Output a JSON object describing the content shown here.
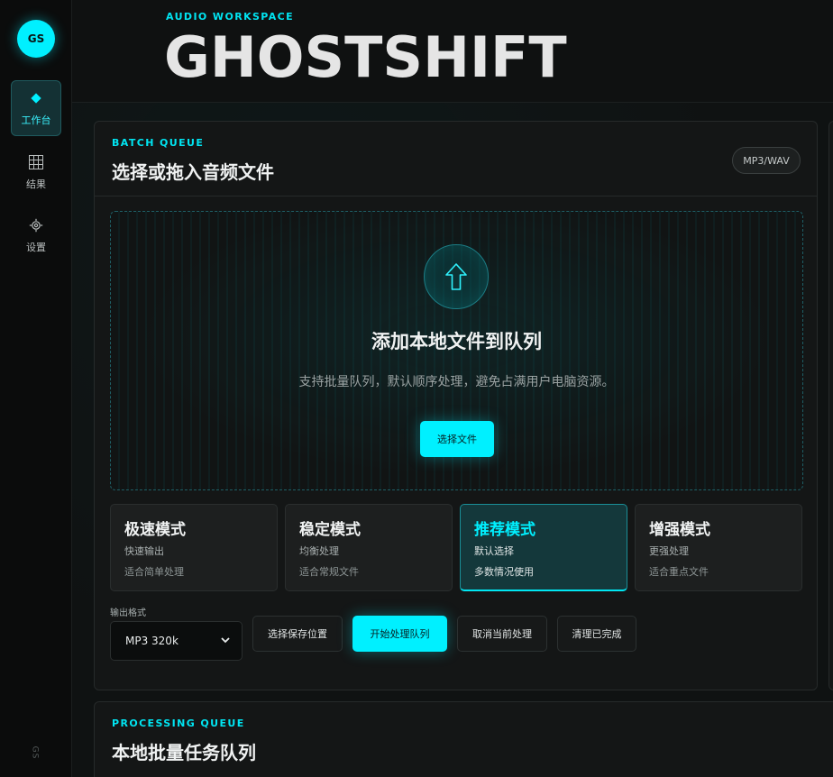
{
  "sidebar": {
    "avatar": "GS",
    "items": [
      {
        "label": "工作台",
        "icon": "diamond-icon"
      },
      {
        "label": "结果",
        "icon": "grid-icon"
      },
      {
        "label": "设置",
        "icon": "gear-icon"
      }
    ],
    "footer": "GS"
  },
  "header": {
    "eyebrow": "AUDIO WORKSPACE",
    "brand": "GHOSTSHIFT"
  },
  "batch": {
    "eyebrow": "BATCH QUEUE",
    "title": "选择或拖入音频文件",
    "badge": "MP3/WAV",
    "dropzone": {
      "title": "添加本地文件到队列",
      "subtitle": "支持批量队列，默认顺序处理，避免占满用户电脑资源。",
      "button": "选择文件"
    },
    "modes": [
      {
        "title": "极速模式",
        "sub": "快速输出",
        "desc": "适合简单处理",
        "active": false
      },
      {
        "title": "稳定模式",
        "sub": "均衡处理",
        "desc": "适合常规文件",
        "active": false
      },
      {
        "title": "推荐模式",
        "sub": "默认选择",
        "desc": "多数情况使用",
        "active": true
      },
      {
        "title": "增强模式",
        "sub": "更强处理",
        "desc": "适合重点文件",
        "active": false
      }
    ],
    "format_label": "输出格式",
    "format_value": "MP3 320k",
    "buttons": {
      "save_location": "选择保存位置",
      "start": "开始处理队列",
      "cancel": "取消当前处理",
      "clear": "清理已完成"
    }
  },
  "processing": {
    "eyebrow": "PROCESSING QUEUE",
    "title": "本地批量任务队列"
  },
  "colors": {
    "accent": "#00f0ff",
    "background": "#0d0f0f",
    "card": "#141616"
  }
}
